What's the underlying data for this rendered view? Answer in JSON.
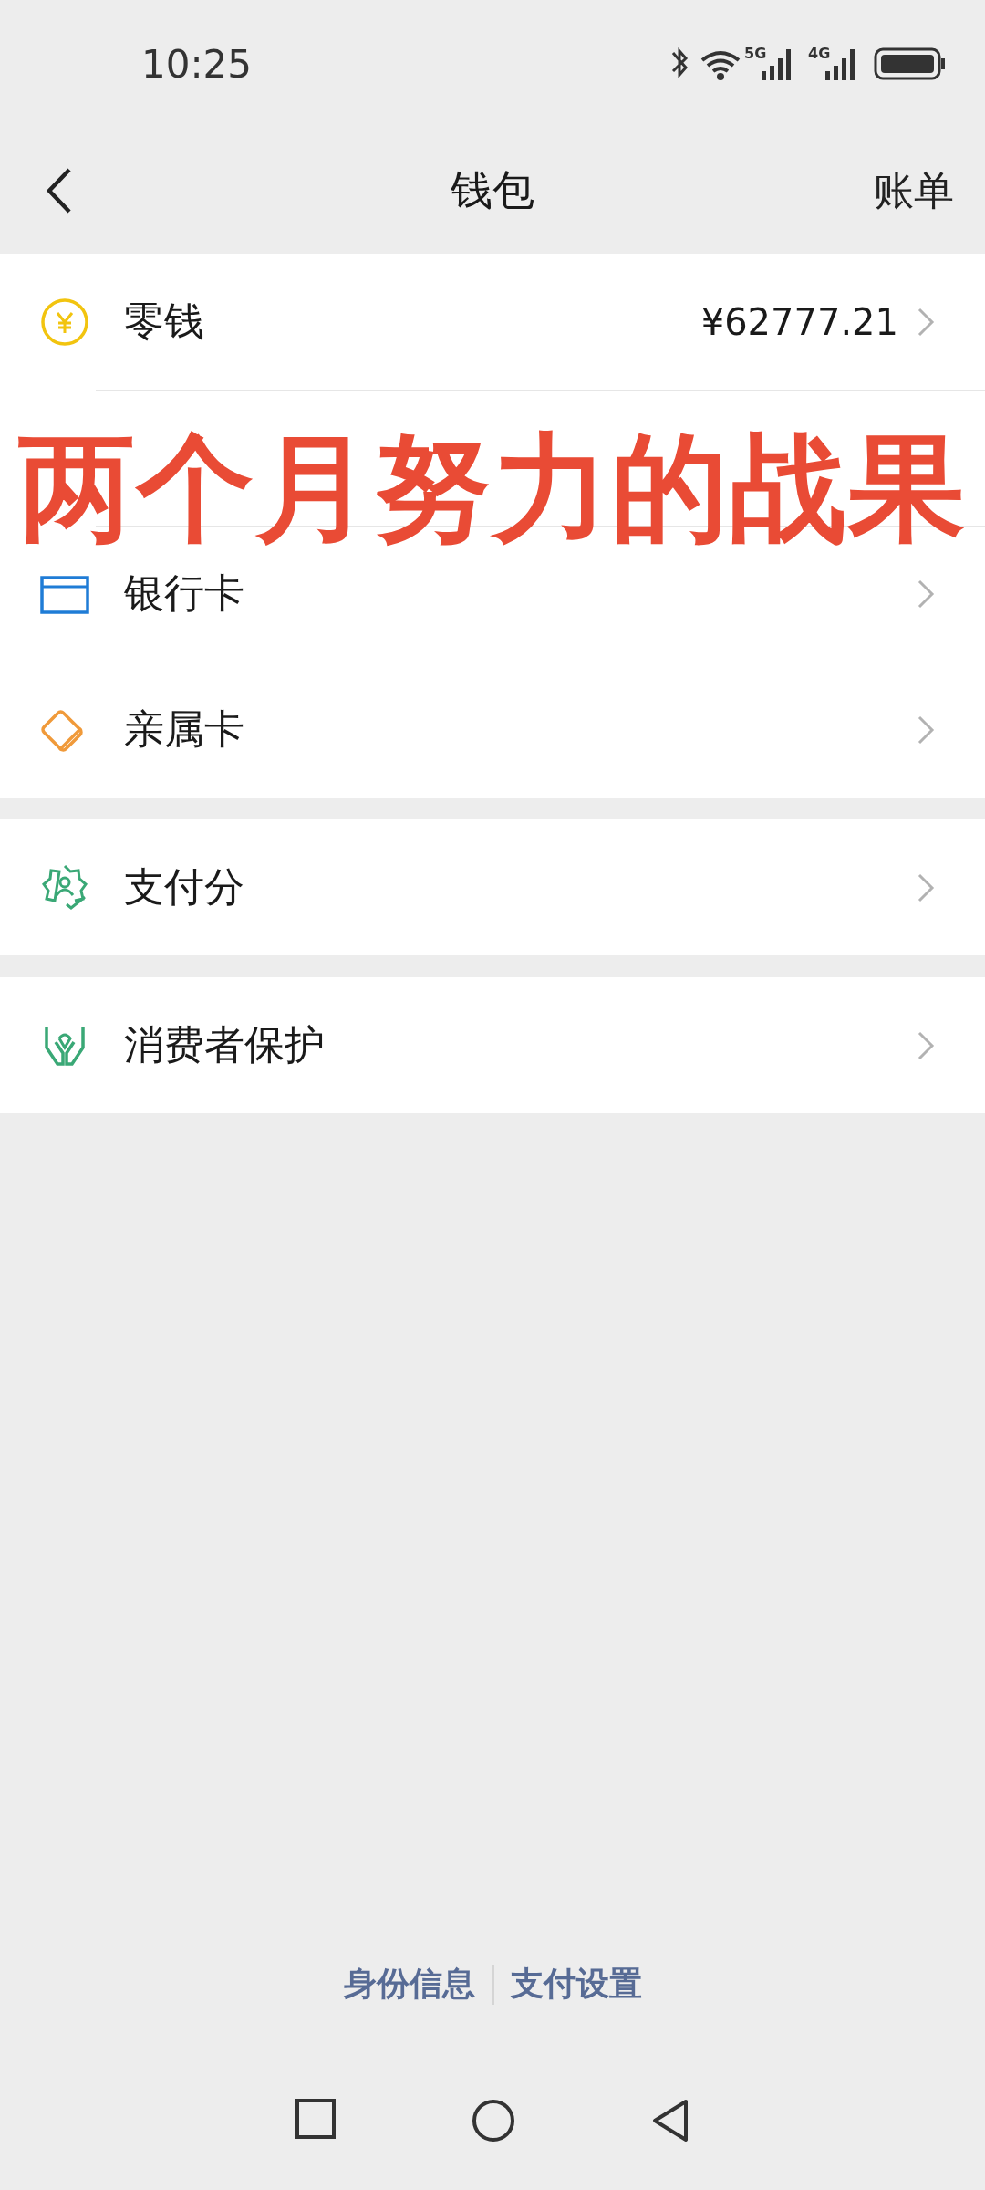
{
  "status_bar": {
    "time": "10:25",
    "networks": [
      "5G",
      "4G"
    ]
  },
  "nav": {
    "title": "钱包",
    "action": "账单"
  },
  "groups": [
    {
      "items": [
        {
          "kind": "coin",
          "label": "零钱",
          "value": "¥62777.21"
        },
        {
          "kind": "covered"
        },
        {
          "kind": "card",
          "label": "银行卡"
        },
        {
          "kind": "family",
          "label": "亲属卡"
        }
      ]
    },
    {
      "items": [
        {
          "kind": "score",
          "label": "支付分"
        }
      ]
    },
    {
      "items": [
        {
          "kind": "protect",
          "label": "消费者保护"
        }
      ]
    }
  ],
  "overlay_caption": "两个月努力的战果",
  "footer_links": [
    "身份信息",
    "支付设置"
  ]
}
